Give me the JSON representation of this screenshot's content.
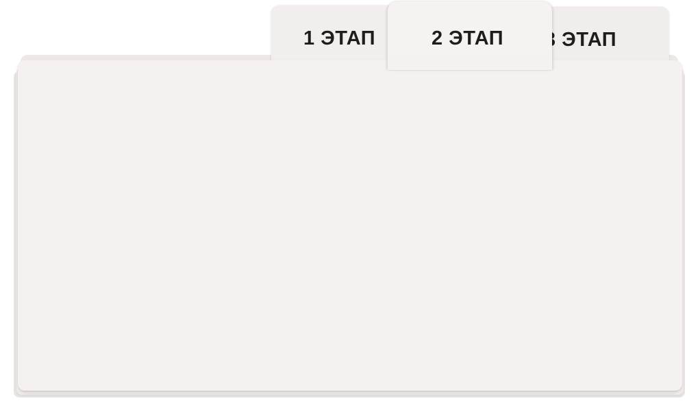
{
  "tabs": [
    {
      "label": "1 ЭТАП",
      "active": false
    },
    {
      "label": "2 ЭТАП",
      "active": true
    },
    {
      "label": "3 ЭТАП",
      "active": false
    }
  ],
  "colors": {
    "card": "#f4f1f0",
    "tab_text": "#1d1d1b"
  }
}
